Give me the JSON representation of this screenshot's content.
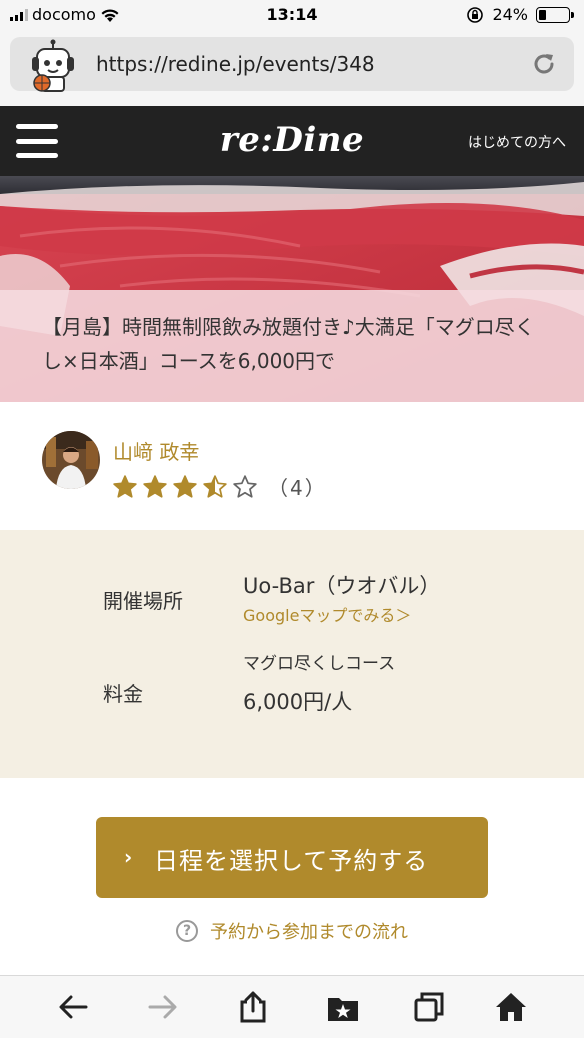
{
  "status": {
    "carrier": "docomo",
    "time": "13:14",
    "battery": "24%",
    "battery_level": 0.24
  },
  "browser": {
    "url": "https://redine.jp/events/348"
  },
  "header": {
    "logo": "re:Dine",
    "first_time_link": "はじめての方へ"
  },
  "event": {
    "title": "【月島】時間無制限飲み放題付き♪大満足「マグロ尽くし×日本酒」コースを6,000円で"
  },
  "host": {
    "name": "山﨑 政幸",
    "rating": 3.5,
    "rating_max": 5,
    "review_count": "（4）"
  },
  "info": {
    "venue_label": "開催場所",
    "venue_name": "Uo-Bar（ウオバル）",
    "map_link": "Googleマップでみる＞",
    "price_label": "料金",
    "course_name": "マグロ尽くしコース",
    "price": "6,000円/人"
  },
  "actions": {
    "reserve_label": "日程を選択して予約する",
    "reserve_chevron": "›",
    "flow_icon": "?",
    "flow_label": "予約から参加までの流れ"
  },
  "colors": {
    "accent": "#b08a2c",
    "header_bg": "#222222",
    "info_bg": "#f4efe3"
  }
}
